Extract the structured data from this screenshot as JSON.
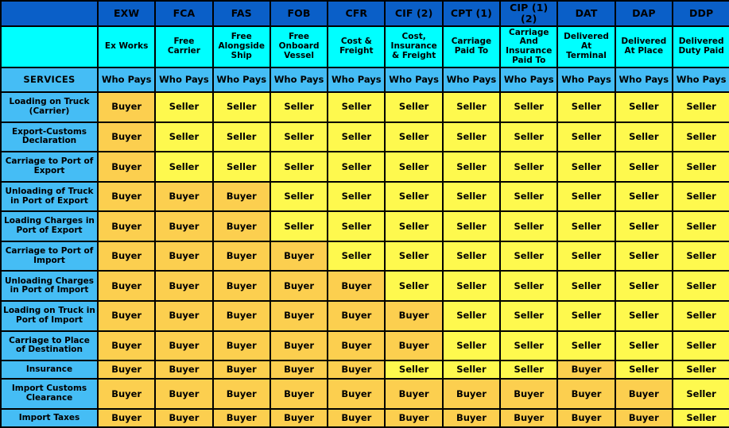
{
  "table": {
    "corner_label": "",
    "services_header": "SERVICES",
    "who_pays_label": "Who Pays",
    "colors": {
      "header_blue": "#0A5FC8",
      "name_cyan": "#00FFFF",
      "light_blue": "#45BDF5",
      "buyer_orange": "#FCCF4F",
      "seller_yellow": "#FEF94E",
      "border": "#000000"
    },
    "terms": [
      {
        "code": "EXW",
        "name": "Ex Works"
      },
      {
        "code": "FCA",
        "name": "Free Carrier"
      },
      {
        "code": "FAS",
        "name": "Free Alongside Ship"
      },
      {
        "code": "FOB",
        "name": "Free Onboard Vessel"
      },
      {
        "code": "CFR",
        "name": "Cost & Freight"
      },
      {
        "code": "CIF (2)",
        "name": "Cost, Insurance & Freight"
      },
      {
        "code": "CPT (1)",
        "name": "Carriage Paid To"
      },
      {
        "code": "CIP (1) (2)",
        "name": "Carriage And Insurance Paid To"
      },
      {
        "code": "DAT",
        "name": "Delivered At Terminal"
      },
      {
        "code": "DAP",
        "name": "Delivered At Place"
      },
      {
        "code": "DDP",
        "name": "Delivered Duty Paid"
      }
    ],
    "rows": [
      {
        "service": "Loading on Truck (Carrier)",
        "values": [
          "Buyer",
          "Seller",
          "Seller",
          "Seller",
          "Seller",
          "Seller",
          "Seller",
          "Seller",
          "Seller",
          "Seller",
          "Seller"
        ]
      },
      {
        "service": "Export-Customs Declaration",
        "values": [
          "Buyer",
          "Seller",
          "Seller",
          "Seller",
          "Seller",
          "Seller",
          "Seller",
          "Seller",
          "Seller",
          "Seller",
          "Seller"
        ]
      },
      {
        "service": "Carriage to Port of Export",
        "values": [
          "Buyer",
          "Seller",
          "Seller",
          "Seller",
          "Seller",
          "Seller",
          "Seller",
          "Seller",
          "Seller",
          "Seller",
          "Seller"
        ]
      },
      {
        "service": "Unloading of Truck in Port of Export",
        "values": [
          "Buyer",
          "Buyer",
          "Buyer",
          "Seller",
          "Seller",
          "Seller",
          "Seller",
          "Seller",
          "Seller",
          "Seller",
          "Seller"
        ]
      },
      {
        "service": "Loading Charges in Port of Export",
        "values": [
          "Buyer",
          "Buyer",
          "Buyer",
          "Seller",
          "Seller",
          "Seller",
          "Seller",
          "Seller",
          "Seller",
          "Seller",
          "Seller"
        ]
      },
      {
        "service": "Carriage to Port of Import",
        "values": [
          "Buyer",
          "Buyer",
          "Buyer",
          "Buyer",
          "Seller",
          "Seller",
          "Seller",
          "Seller",
          "Seller",
          "Seller",
          "Seller"
        ]
      },
      {
        "service": "Unloading Charges in Port of Import",
        "values": [
          "Buyer",
          "Buyer",
          "Buyer",
          "Buyer",
          "Buyer",
          "Seller",
          "Seller",
          "Seller",
          "Seller",
          "Seller",
          "Seller"
        ]
      },
      {
        "service": "Loading on Truck in Port of Import",
        "values": [
          "Buyer",
          "Buyer",
          "Buyer",
          "Buyer",
          "Buyer",
          "Buyer",
          "Seller",
          "Seller",
          "Seller",
          "Seller",
          "Seller"
        ]
      },
      {
        "service": "Carriage to Place of Destination",
        "values": [
          "Buyer",
          "Buyer",
          "Buyer",
          "Buyer",
          "Buyer",
          "Buyer",
          "Seller",
          "Seller",
          "Seller",
          "Seller",
          "Seller"
        ]
      },
      {
        "service": "Insurance",
        "values": [
          "Buyer",
          "Buyer",
          "Buyer",
          "Buyer",
          "Buyer",
          "Seller",
          "Seller",
          "Seller",
          "Buyer",
          "Seller",
          "Seller"
        ]
      },
      {
        "service": "Import Customs Clearance",
        "values": [
          "Buyer",
          "Buyer",
          "Buyer",
          "Buyer",
          "Buyer",
          "Buyer",
          "Buyer",
          "Buyer",
          "Buyer",
          "Buyer",
          "Seller"
        ]
      },
      {
        "service": "Import Taxes",
        "values": [
          "Buyer",
          "Buyer",
          "Buyer",
          "Buyer",
          "Buyer",
          "Buyer",
          "Buyer",
          "Buyer",
          "Buyer",
          "Buyer",
          "Seller"
        ]
      }
    ]
  }
}
